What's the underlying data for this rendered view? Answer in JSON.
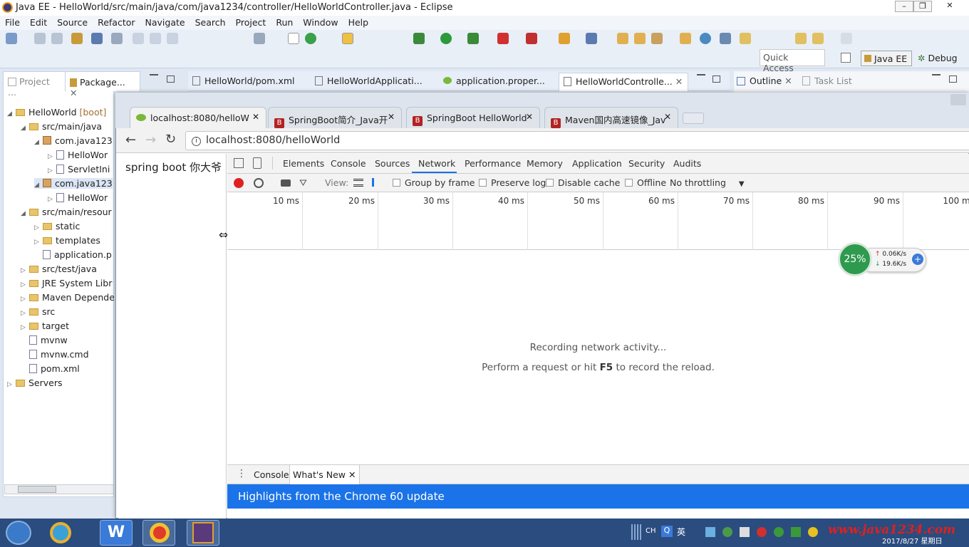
{
  "window": {
    "title": "Java EE - HelloWorld/src/main/java/com/java1234/controller/HelloWorldController.java - Eclipse"
  },
  "menu": [
    "File",
    "Edit",
    "Source",
    "Refactor",
    "Navigate",
    "Search",
    "Project",
    "Run",
    "Window",
    "Help"
  ],
  "quick_access": "Quick Access",
  "perspectives": {
    "active": "Java EE",
    "other": "Debug"
  },
  "left_tabs": [
    "Project ...",
    "Package..."
  ],
  "tree": [
    {
      "label": "HelloWorld",
      "suffix": "[boot]",
      "indent": 0,
      "kind": "project"
    },
    {
      "label": "src/main/java",
      "indent": 1,
      "kind": "folder"
    },
    {
      "label": "com.java123",
      "indent": 2,
      "kind": "pkg"
    },
    {
      "label": "HelloWor",
      "indent": 3,
      "kind": "file"
    },
    {
      "label": "ServletIni",
      "indent": 3,
      "kind": "file"
    },
    {
      "label": "com.java123",
      "indent": 2,
      "kind": "pkg"
    },
    {
      "label": "HelloWor",
      "indent": 3,
      "kind": "file"
    },
    {
      "label": "src/main/resour",
      "indent": 1,
      "kind": "folder"
    },
    {
      "label": "static",
      "indent": 2,
      "kind": "folder"
    },
    {
      "label": "templates",
      "indent": 2,
      "kind": "folder"
    },
    {
      "label": "application.p",
      "indent": 2,
      "kind": "file"
    },
    {
      "label": "src/test/java",
      "indent": 1,
      "kind": "folder"
    },
    {
      "label": "JRE System Libr",
      "indent": 1,
      "kind": "folder"
    },
    {
      "label": "Maven Depende",
      "indent": 1,
      "kind": "folder"
    },
    {
      "label": "src",
      "indent": 1,
      "kind": "folder"
    },
    {
      "label": "target",
      "indent": 1,
      "kind": "folder"
    },
    {
      "label": "mvnw",
      "indent": 1,
      "kind": "file"
    },
    {
      "label": "mvnw.cmd",
      "indent": 1,
      "kind": "file"
    },
    {
      "label": "pom.xml",
      "indent": 1,
      "kind": "file"
    },
    {
      "label": "Servers",
      "indent": 0,
      "kind": "folder"
    }
  ],
  "editor_tabs": [
    "HelloWorld/pom.xml",
    "HelloWorldApplicati...",
    "application.proper...",
    "HelloWorldControlle..."
  ],
  "right_tabs": [
    "Outline",
    "Task List"
  ],
  "browser": {
    "tabs": [
      "localhost:8080/helloW",
      "SpringBoot简介_Java开",
      "SpringBoot HelloWorld",
      "Maven国内高速镜像_Jav"
    ],
    "url": "localhost:8080/helloWorld",
    "page_text": "spring boot 你大爷"
  },
  "devtools": {
    "tabs": [
      "Elements",
      "Console",
      "Sources",
      "Network",
      "Performance",
      "Memory",
      "Application",
      "Security",
      "Audits"
    ],
    "active_tab": "Network",
    "toolbar": {
      "view": "View:",
      "group": "Group by frame",
      "preserve": "Preserve log",
      "disable": "Disable cache",
      "offline": "Offline",
      "throttle": "No throttling"
    },
    "ticks": [
      "10 ms",
      "20 ms",
      "30 ms",
      "40 ms",
      "50 ms",
      "60 ms",
      "70 ms",
      "80 ms",
      "90 ms",
      "100 ms"
    ],
    "empty1": "Recording network activity...",
    "empty2a": "Perform a request or hit ",
    "empty2b": "F5",
    "empty2c": " to record the reload.",
    "drawer_tabs": [
      "Console",
      "What's New"
    ],
    "banner": "Highlights from the Chrome 60 update"
  },
  "widget": {
    "percent": "25%",
    "up": "0.06K/s",
    "down": "19.6K/s"
  },
  "taskbar": {
    "ime1": "CH",
    "ime2": "英",
    "date": "2017/8/27 星期日",
    "watermark": "www.java1234.com"
  }
}
